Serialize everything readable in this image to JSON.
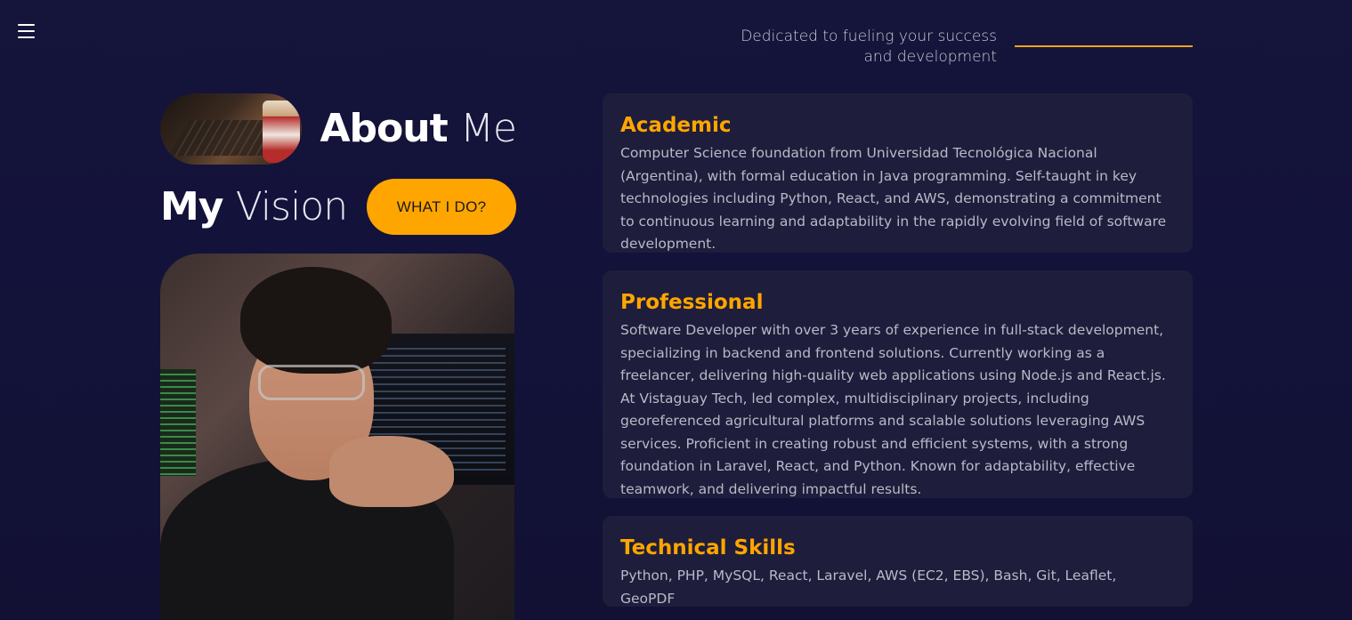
{
  "nav": {
    "menu_icon": "hamburger-menu-icon"
  },
  "header": {
    "tagline_line1": "Dedicated to fueling your success",
    "tagline_line2": "and development",
    "accent_color": "#f0a31c"
  },
  "hero": {
    "about_bold": "About",
    "about_light": "Me",
    "vision_bold": "My",
    "vision_light": "Vision",
    "cta_label": "WHAT I DO?",
    "cta_color": "#ffa500"
  },
  "cards": [
    {
      "title": "Academic",
      "body": "Computer Science foundation from Universidad Tecnológica Nacional (Argentina), with formal education in Java programming. Self-taught in key technologies including Python, React, and AWS, demonstrating a commitment to continuous learning and adaptability in the rapidly evolving field of software development."
    },
    {
      "title": "Professional",
      "body": "Software Developer with over 3 years of experience in full-stack development, specializing in backend and frontend solutions. Currently working as a freelancer, delivering high-quality web applications using Node.js and React.js. At Vistaguay Tech, led complex, multidisciplinary projects, including georeferenced agricultural platforms and scalable solutions leveraging AWS services. Proficient in creating robust and efficient systems, with a strong foundation in Laravel, React, and Python. Known for adaptability, effective teamwork, and delivering impactful results."
    },
    {
      "title": "Technical Skills",
      "body": "Python, PHP, MySQL, React, Laravel, AWS (EC2, EBS), Bash, Git, Leaflet, GeoPDF"
    }
  ],
  "colors": {
    "background": "#14133a",
    "card_background": "#1e1d3b",
    "heading_accent": "#ffa500",
    "body_text": "#b9b9c8"
  }
}
